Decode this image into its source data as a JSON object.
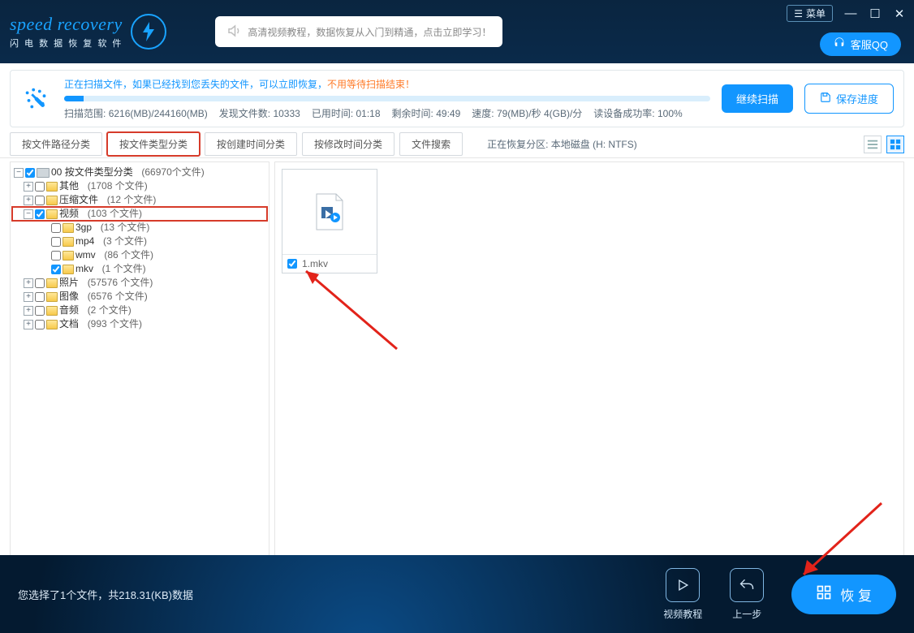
{
  "header": {
    "brand": "speed recovery",
    "brand_sub": "闪 电 数 据 恢 复 软 件",
    "ad_text": "高清视频教程，数据恢复从入门到精通，点击立即学习！",
    "menu_label": "菜单",
    "kefu_label": "客服QQ"
  },
  "scan": {
    "msg_blue": "正在扫描文件，如果已经找到您丢失的文件，可以立即恢复，",
    "msg_orange": "不用等待扫描结束！",
    "range_label": "扫描范围:",
    "range_value": "6216(MB)/244160(MB)",
    "found_label": "发现文件数:",
    "found_value": "10333",
    "elapsed_label": "已用时间:",
    "elapsed_value": "01:18",
    "remain_label": "剩余时间:",
    "remain_value": "49:49",
    "speed_label": "速度:",
    "speed_value": "79(MB)/秒  4(GB)/分",
    "readrate_label": "读设备成功率:",
    "readrate_value": "100%",
    "btn_continue": "继续扫描",
    "btn_save": "保存进度"
  },
  "tabs": {
    "t1": "按文件路径分类",
    "t2": "按文件类型分类",
    "t3": "按创建时间分类",
    "t4": "按修改时间分类",
    "t5": "文件搜索",
    "partition": "正在恢复分区: 本地磁盘 (H: NTFS)"
  },
  "tree": {
    "root_prefix": "00",
    "root_label": "按文件类型分类",
    "root_count": "(66970个文件)",
    "n_other": "其他",
    "c_other": "(1708 个文件)",
    "n_zip": "压缩文件",
    "c_zip": "(12 个文件)",
    "n_video": "视频",
    "c_video": "(103 个文件)",
    "n_3gp": "3gp",
    "c_3gp": "(13 个文件)",
    "n_mp4": "mp4",
    "c_mp4": "(3 个文件)",
    "n_wmv": "wmv",
    "c_wmv": "(86 个文件)",
    "n_mkv": "mkv",
    "c_mkv": "(1 个文件)",
    "n_photo": "照片",
    "c_photo": "(57576 个文件)",
    "n_image": "图像",
    "c_image": "(6576 个文件)",
    "n_audio": "音频",
    "c_audio": "(2 个文件)",
    "n_doc": "文档",
    "c_doc": "(993 个文件)"
  },
  "file": {
    "name": "1.mkv"
  },
  "footer": {
    "selection": "您选择了1个文件，共218.31(KB)数据",
    "tutorial": "视频教程",
    "prev": "上一步",
    "recover": "恢 复"
  }
}
